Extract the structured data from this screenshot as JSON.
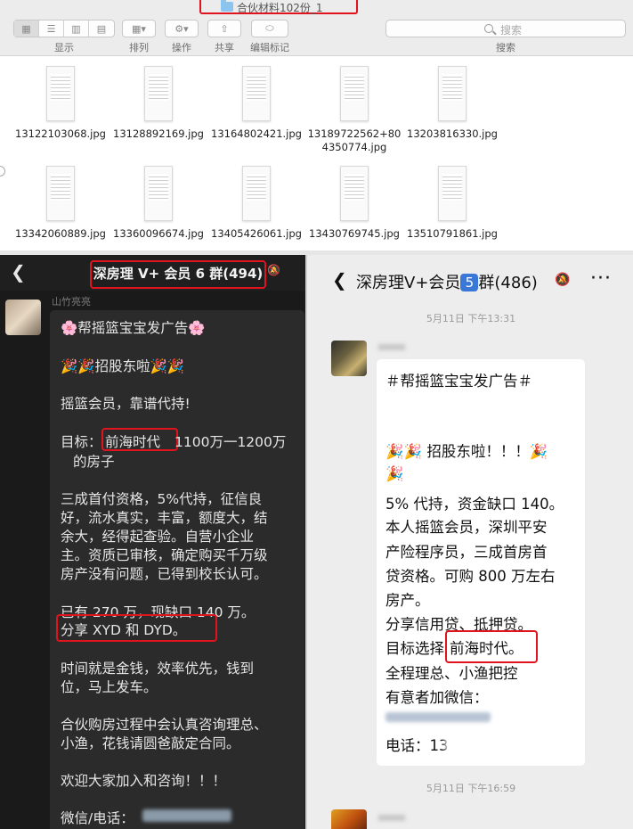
{
  "finder": {
    "window_title": "合伙材料102份_1",
    "toolbar": {
      "view_label": "显示",
      "arrange_label": "排列",
      "action_label": "操作",
      "share_label": "共享",
      "tags_label": "编辑标记",
      "search_placeholder": "搜索",
      "search_label": "搜索"
    },
    "files": [
      {
        "name": "13122103068.jpg"
      },
      {
        "name": "13128892169.jpg"
      },
      {
        "name": "13164802421.jpg"
      },
      {
        "name_line1": "13189722562+80",
        "name_line2": "4350774.jpg"
      },
      {
        "name": "13203816330.jpg"
      },
      {
        "name": "13342060889.jpg"
      },
      {
        "name": "13360096674.jpg"
      },
      {
        "name": "13405426061.jpg"
      },
      {
        "name": "13430769745.jpg"
      },
      {
        "name": "13510791861.jpg"
      }
    ]
  },
  "left_chat": {
    "back_icon": "chevron-left",
    "title": "深房理 V+ 会员 6 群(494)",
    "sender": "山竹亮亮",
    "lines": [
      "🌸帮摇篮宝宝发广告🌸",
      "🎉🎉招股东啦🎉🎉",
      "摇篮会员，靠谱代持!",
      "目标：",
      "前海时代",
      "1100万一1200万",
      "的房子",
      "三成首付资格，5%代持，征信良",
      "好，流水真实，丰富，额度大，结",
      "余大，经得起查验。自营小企业",
      "主。资质已审核，确定购买千万级",
      "房产没有问题，已得到校长认可。",
      "已有 270 万，现缺口 140 万。",
      "分享 XYD 和 DYD。",
      "时间就是金钱，效率优先，钱到",
      "位，马上发车。",
      "合伙购房过程中会认真咨询理总、",
      "小渔，花钱请圆爸敲定合同。",
      "欢迎大家加入和咨询！！！",
      "微信/电话："
    ]
  },
  "right_chat": {
    "back_icon": "chevron-left",
    "title_prefix": "深房理V+会员",
    "title_badge": "5",
    "title_suffix": "群(486)",
    "more": "···",
    "time1": "5月11日 下午13:31",
    "time2": "5月11日 下午16:59",
    "lines": [
      "＃帮摇篮宝宝发广告＃",
      "🎉🎉 招股东啦！！！🎉",
      "🎉",
      "5% 代持，资金缺口 140。",
      "本人摇篮会员，深圳平安",
      "产险程序员，三成首房首",
      "贷资格。可购 800 万左右",
      "房产。",
      "分享信用贷、抵押贷。",
      "目标选择",
      "前海时代。",
      "全程理总、小渔把控",
      "有意者加微信：",
      "电话：13"
    ]
  }
}
